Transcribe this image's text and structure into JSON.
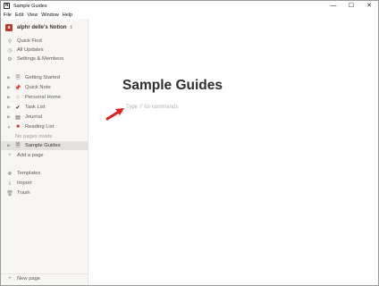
{
  "window": {
    "title": "Sample Guides",
    "app_icon": "N",
    "controls": [
      "—",
      "☐",
      "✕"
    ]
  },
  "menu": [
    "File",
    "Edit",
    "View",
    "Window",
    "Help"
  ],
  "workspace": {
    "avatar": "a",
    "name": "alphr delle's Notion",
    "chevron": "⌃⌄"
  },
  "sidebar": {
    "top_items": [
      {
        "icon": "search-icon",
        "label": "Quick Find"
      },
      {
        "icon": "clock-icon",
        "label": "All Updates"
      },
      {
        "icon": "gear-icon",
        "label": "Settings & Members"
      }
    ],
    "pages": [
      {
        "label": "Getting Started",
        "expanded": false
      },
      {
        "label": "Quick Note",
        "expanded": false
      },
      {
        "label": "Personal Home",
        "expanded": false
      },
      {
        "label": "Task List",
        "expanded": false
      },
      {
        "label": "Journal",
        "expanded": false
      },
      {
        "label": "Reading List",
        "expanded": true
      },
      {
        "label": "No pages inside"
      },
      {
        "label": "Sample Guides",
        "expanded": false,
        "selected": true
      }
    ],
    "add_page": "Add a page",
    "bottom_items": [
      {
        "icon": "templates-icon",
        "label": "Templates"
      },
      {
        "icon": "import-icon",
        "label": "Import"
      },
      {
        "icon": "trash-icon",
        "label": "Trash"
      }
    ],
    "new_page": "New page"
  },
  "main": {
    "title": "Sample Guides",
    "placeholder": "Type '/' for commands"
  },
  "colors": {
    "sidebar_bg": "#f7f6f3",
    "selected_bg": "#e3e2df",
    "arrow": "#e02020"
  }
}
